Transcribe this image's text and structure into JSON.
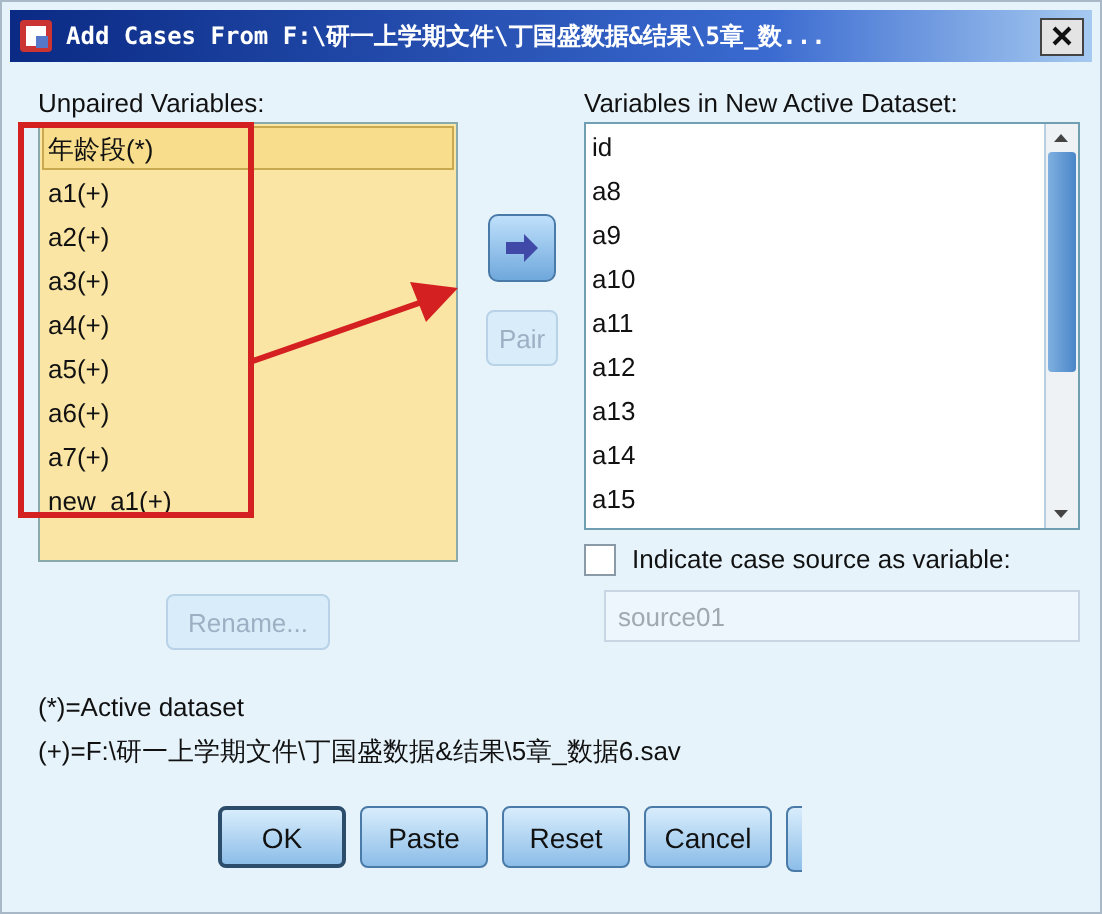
{
  "window": {
    "title": "Add Cases From F:\\研一上学期文件\\丁国盛数据&结果\\5章_数..."
  },
  "unpaired": {
    "label": "Unpaired Variables:",
    "items": [
      {
        "text": "年龄段(*)",
        "selected": true
      },
      {
        "text": "a1(+)",
        "selected": false
      },
      {
        "text": "a2(+)",
        "selected": false
      },
      {
        "text": "a3(+)",
        "selected": false
      },
      {
        "text": "a4(+)",
        "selected": false
      },
      {
        "text": "a5(+)",
        "selected": false
      },
      {
        "text": "a6(+)",
        "selected": false
      },
      {
        "text": "a7(+)",
        "selected": false
      },
      {
        "text": "new_a1(+)",
        "selected": false
      }
    ]
  },
  "pair_button": {
    "label": "Pair",
    "disabled": true
  },
  "rename_button": {
    "label": "Rename...",
    "disabled": true
  },
  "new_dataset": {
    "label": "Variables in New Active Dataset:",
    "items": [
      "id",
      "a8",
      "a9",
      "a10",
      "a11",
      "a12",
      "a13",
      "a14",
      "a15"
    ]
  },
  "indicate_source": {
    "label": "Indicate case source as variable:",
    "checked": false
  },
  "source_field": {
    "value": "source01",
    "disabled": true
  },
  "legend": [
    "(*)=Active dataset",
    "(+)=F:\\研一上学期文件\\丁国盛数据&结果\\5章_数据6.sav"
  ],
  "buttons": [
    {
      "label": "OK",
      "default": true
    },
    {
      "label": "Paste",
      "default": false
    },
    {
      "label": "Reset",
      "default": false
    },
    {
      "label": "Cancel",
      "default": false
    }
  ]
}
